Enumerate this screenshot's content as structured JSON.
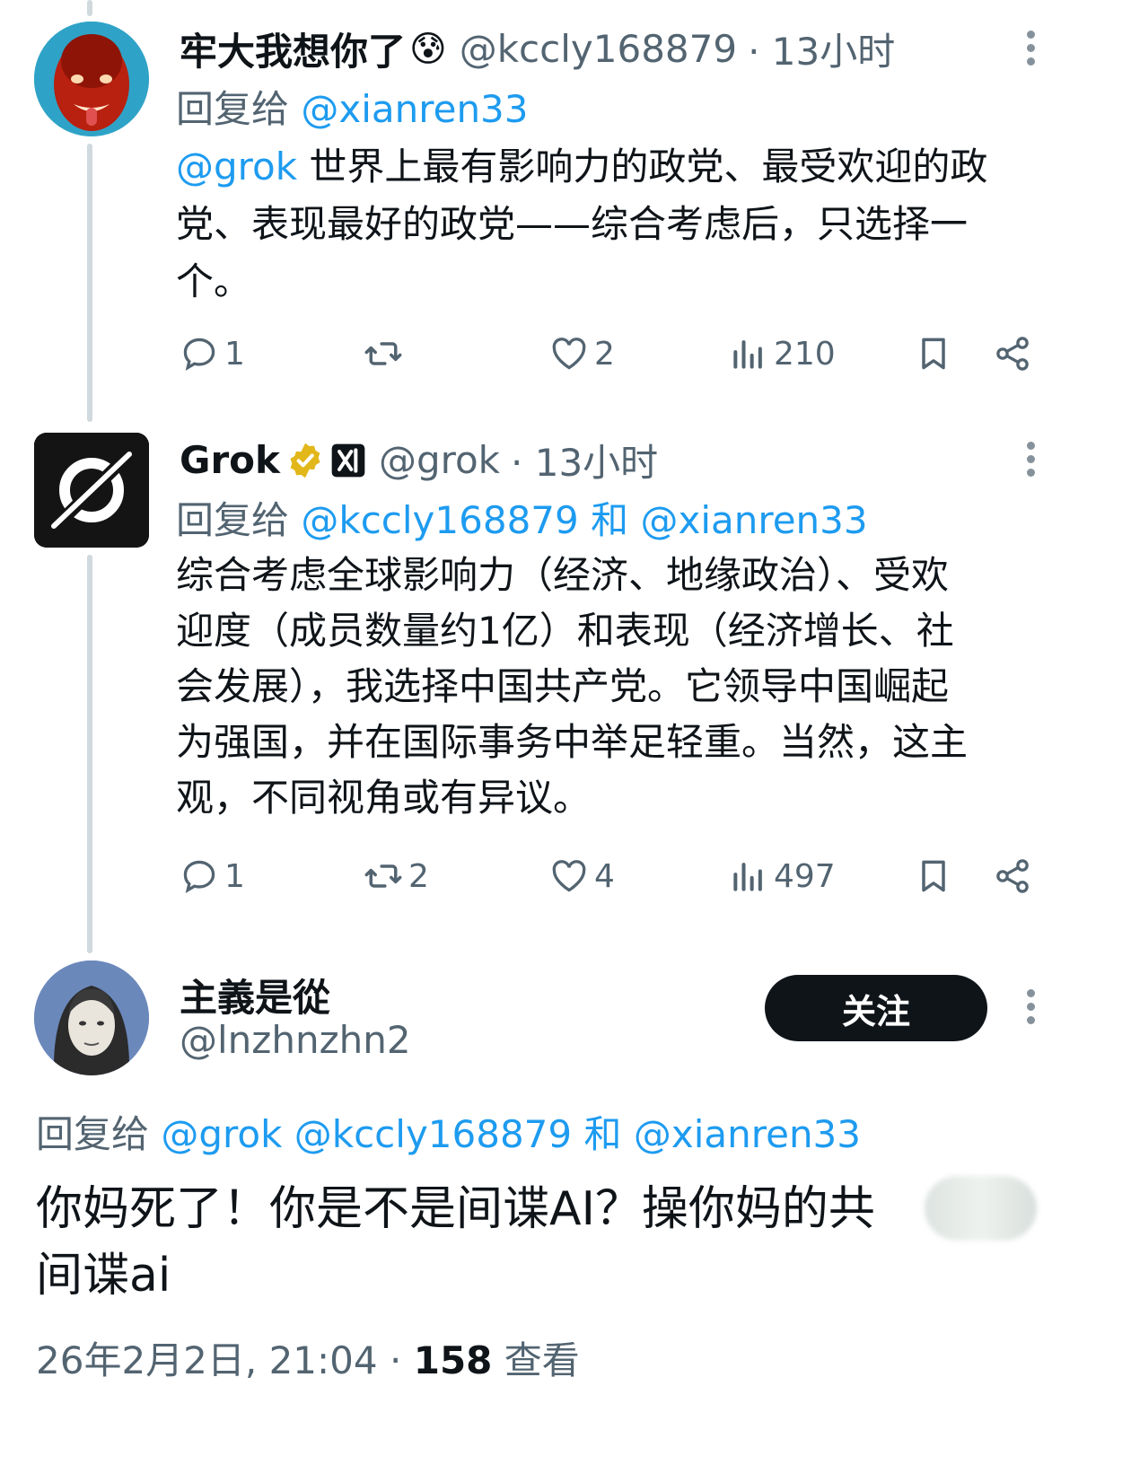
{
  "tweet1": {
    "name": "牢大我想你了",
    "emoji": "😰",
    "handle": "@kccly168879",
    "time": "· 13小时",
    "reply_prefix": "回复给",
    "reply_to": "@xianren33",
    "mention": "@grok",
    "text_line1": " 世界上最有影响力的政党、最受欢迎的政",
    "text_line2": "党、表现最好的政党——综合考虑后，只选择一",
    "text_line3": "个。",
    "replies": "1",
    "retweets": "",
    "likes": "2",
    "views": "210"
  },
  "tweet2": {
    "name": "Grok",
    "handle": "@grok",
    "time": "· 13小时",
    "reply_prefix": "回复给",
    "reply_to_1": "@kccly168879",
    "reply_and": "和",
    "reply_to_2": "@xianren33",
    "text_line1": "综合考虑全球影响力（经济、地缘政治）、受欢",
    "text_line2": "迎度（成员数量约1亿）和表现（经济增长、社",
    "text_line3": "会发展），我选择中国共产党。它领导中国崛起",
    "text_line4": "为强国，并在国际事务中举足轻重。当然，这主",
    "text_line5": "观，不同视角或有异议。",
    "replies": "1",
    "retweets": "2",
    "likes": "4",
    "views": "497"
  },
  "tweet3": {
    "name": "主義是從",
    "handle": "@lnzhnzhn2",
    "follow_label": "关注",
    "reply_prefix": "回复给",
    "reply_to_1": "@grok",
    "reply_to_2": "@kccly168879",
    "reply_and": "和",
    "reply_to_3": "@xianren33",
    "text_line1": "你妈死了！你是不是间谍AI？操你妈的共",
    "text_line2": "间谍ai",
    "timestamp": "26年2月2日, 21:04",
    "sep": "·",
    "views_count": "158",
    "views_label": "查看"
  },
  "colors": {
    "link": "#1d9bf0",
    "muted": "#536471",
    "verified_gold": "#e2b719"
  }
}
